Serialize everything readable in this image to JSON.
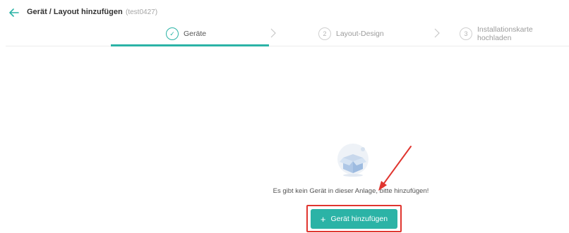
{
  "header": {
    "title": "Gerät / Layout hinzufügen",
    "subtitle": "(test0427)"
  },
  "steps": [
    {
      "label": "Geräte",
      "marker": "✓",
      "state": "active"
    },
    {
      "label": "Layout-Design",
      "marker": "2",
      "state": "inactive"
    },
    {
      "label": "Installationskarte hochladen",
      "marker": "3",
      "state": "inactive"
    }
  ],
  "empty_state": {
    "message": "Es gibt kein Gerät in dieser Anlage, bitte hinzufügen!",
    "button_label": "Gerät hinzufügen",
    "button_icon": "plus-icon"
  },
  "colors": {
    "accent": "#2bb3a6",
    "annotation_red": "#e0352f"
  }
}
